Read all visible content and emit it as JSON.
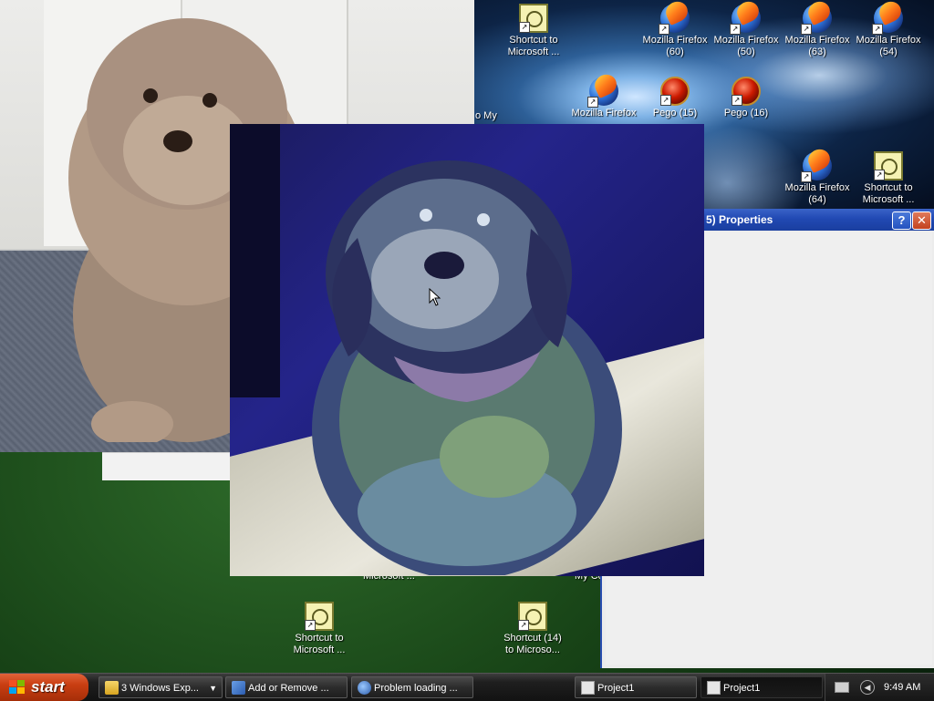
{
  "desktop": {
    "icons": [
      {
        "id": "ms-shortcut-top",
        "type": "ms-shortcut",
        "label_line1": "Shortcut to",
        "label_line2": "Microsoft ..."
      },
      {
        "id": "ff-60",
        "type": "firefox",
        "label_line1": "Mozilla Firefox",
        "label_line2": "(60)"
      },
      {
        "id": "ff-50",
        "type": "firefox",
        "label_line1": "Mozilla Firefox",
        "label_line2": "(50)"
      },
      {
        "id": "ff-63",
        "type": "firefox",
        "label_line1": "Mozilla Firefox",
        "label_line2": "(63)"
      },
      {
        "id": "ff-54",
        "type": "firefox",
        "label_line1": "Mozilla Firefox",
        "label_line2": "(54)"
      },
      {
        "id": "ff-plain",
        "type": "firefox",
        "label_line1": "Mozilla Firefox",
        "label_line2": ""
      },
      {
        "id": "pego-15",
        "type": "pego",
        "label_line1": "Pego (15)",
        "label_line2": ""
      },
      {
        "id": "pego-16",
        "type": "pego",
        "label_line1": "Pego (16)",
        "label_line2": ""
      },
      {
        "id": "ff-64",
        "type": "firefox",
        "label_line1": "Mozilla Firefox",
        "label_line2": "(64)"
      },
      {
        "id": "ms-shortcut-right",
        "type": "ms-shortcut",
        "label_line1": "Shortcut to",
        "label_line2": "Microsoft ..."
      },
      {
        "id": "ms-shortcut-bottom",
        "type": "ms-shortcut",
        "label_line1": "Shortcut to",
        "label_line2": "Microsoft ..."
      },
      {
        "id": "ms-shortcut-14",
        "type": "ms-shortcut",
        "label_line1": "Shortcut (14)",
        "label_line2": "to Microso..."
      }
    ],
    "fragments": {
      "my": "o My",
      "microsoft": "Microsoft ...",
      "my_co": "My Co"
    }
  },
  "properties_window": {
    "title": "5) Properties",
    "help_glyph": "?",
    "close_glyph": "✕"
  },
  "taskbar": {
    "start_label": "start",
    "tasks": [
      {
        "label": "3 Windows Exp...",
        "icon": "folder-icon",
        "active": false
      },
      {
        "label": "Add or Remove ...",
        "icon": "add-remove-icon",
        "active": false
      },
      {
        "label": "Problem loading ...",
        "icon": "globe-icon",
        "active": false
      },
      {
        "label": "Project1",
        "icon": "project-icon",
        "active": false
      },
      {
        "label": "Project1",
        "icon": "project-icon",
        "active": true
      }
    ],
    "clock": "9:49 AM"
  },
  "colors": {
    "titlebar": "#2149b3",
    "start": "#c93e12",
    "taskbar": "#1f1f1f"
  }
}
